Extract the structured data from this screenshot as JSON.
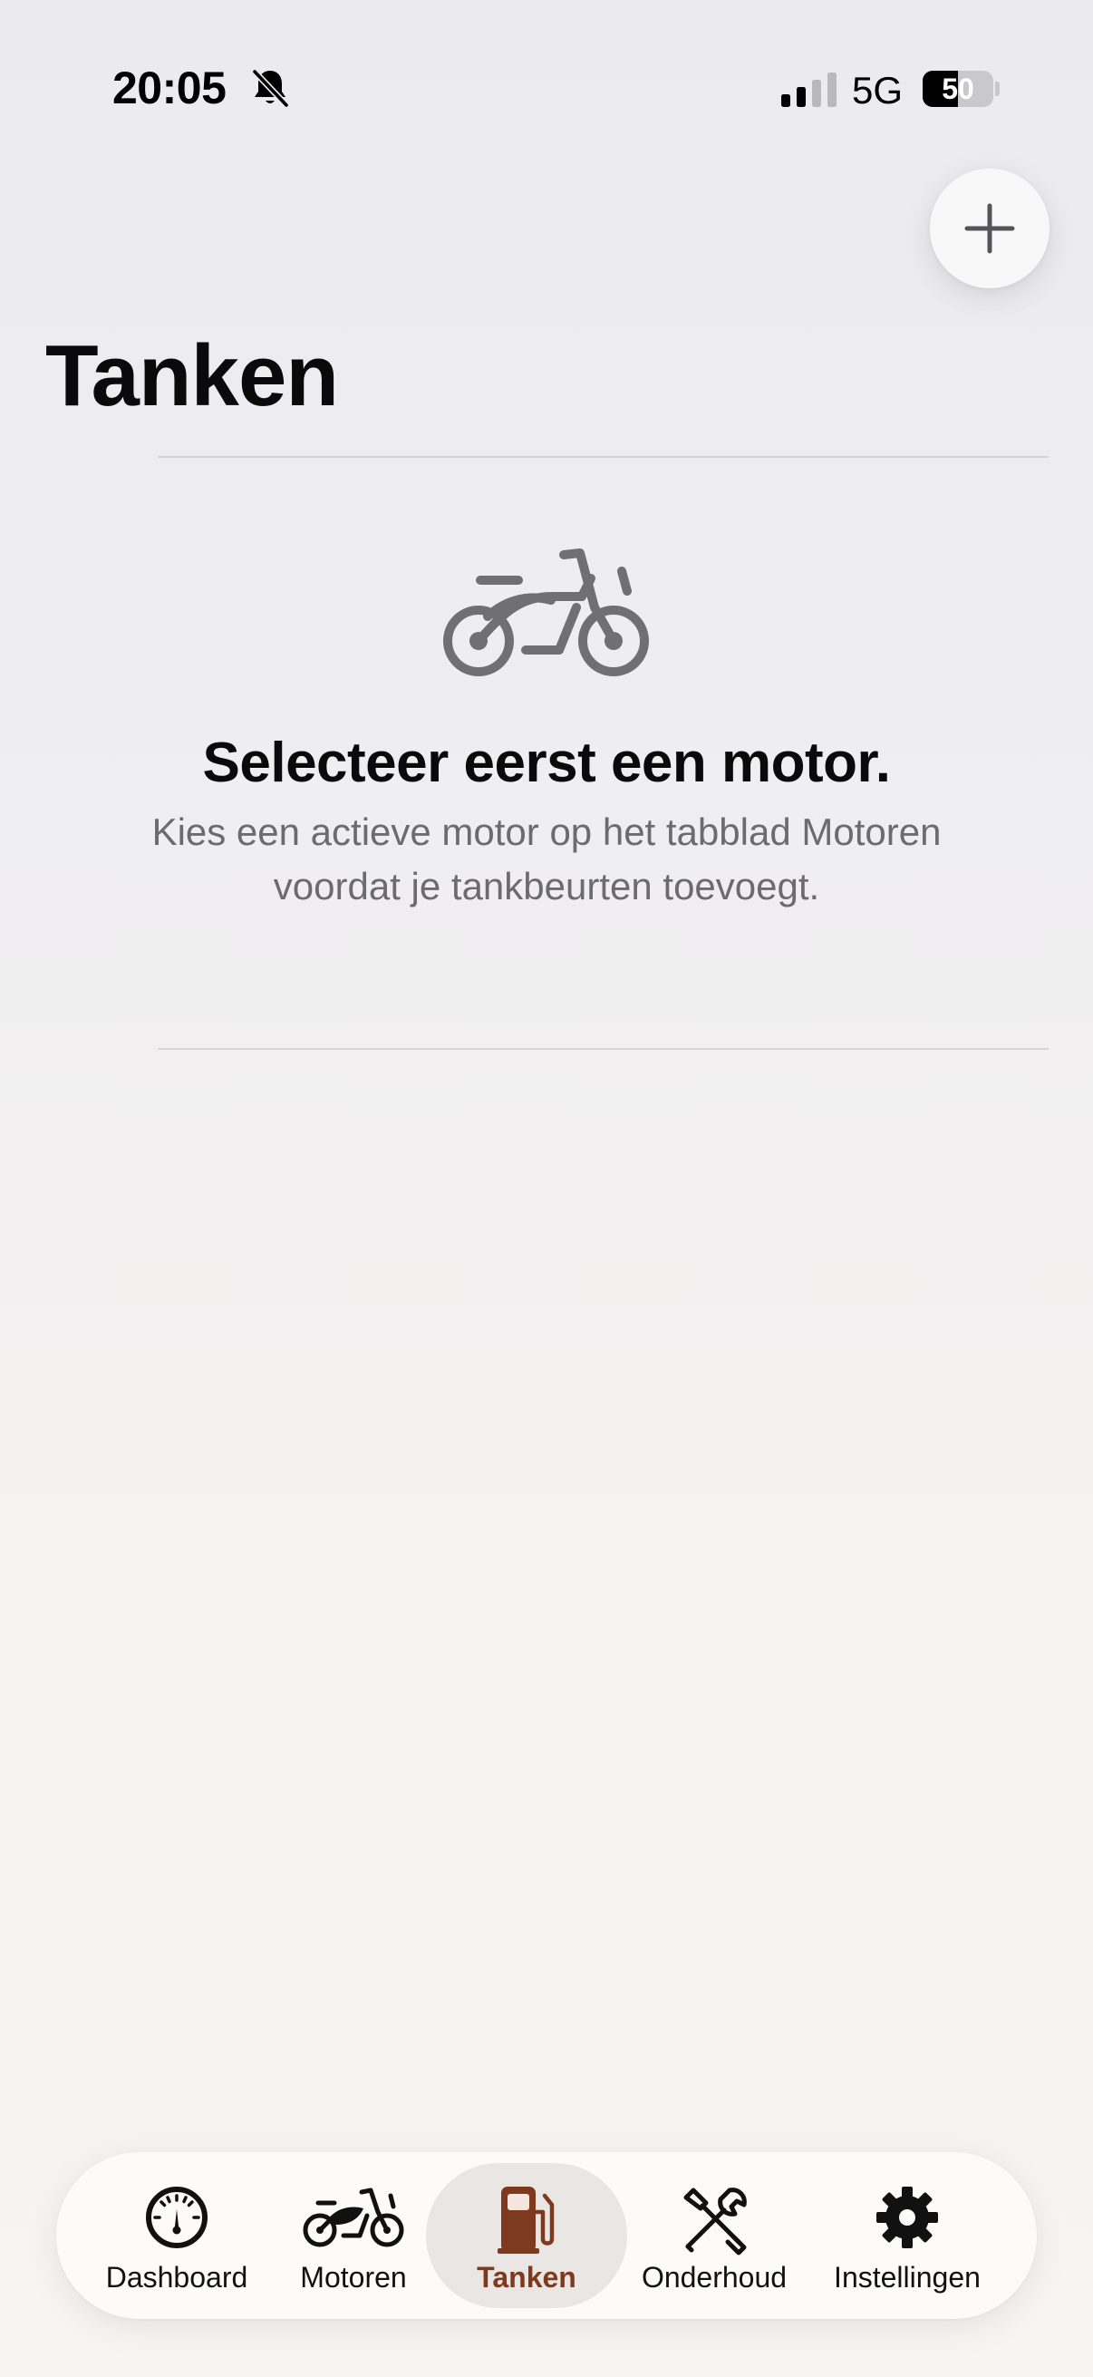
{
  "status_bar": {
    "time": "20:05",
    "network": "5G",
    "battery_level": "50",
    "battery_fraction": 0.5
  },
  "header": {
    "title": "Tanken",
    "add_button_icon": "plus-icon"
  },
  "empty_state": {
    "icon": "motorcycle-icon",
    "title": "Selecteer eerst een motor.",
    "message": "Kies een actieve motor op het tabblad Motoren voordat je tankbeurten toevoegt."
  },
  "tab_bar": {
    "active_tab": "tanken",
    "accent_color": "#7d3a1e",
    "tabs": [
      {
        "id": "dashboard",
        "label": "Dashboard",
        "icon": "gauge-icon"
      },
      {
        "id": "motoren",
        "label": "Motoren",
        "icon": "motorcycle-icon"
      },
      {
        "id": "tanken",
        "label": "Tanken",
        "icon": "fuel-pump-icon"
      },
      {
        "id": "onderhoud",
        "label": "Onderhoud",
        "icon": "tools-icon"
      },
      {
        "id": "instellingen",
        "label": "Instellingen",
        "icon": "gear-icon"
      }
    ]
  }
}
